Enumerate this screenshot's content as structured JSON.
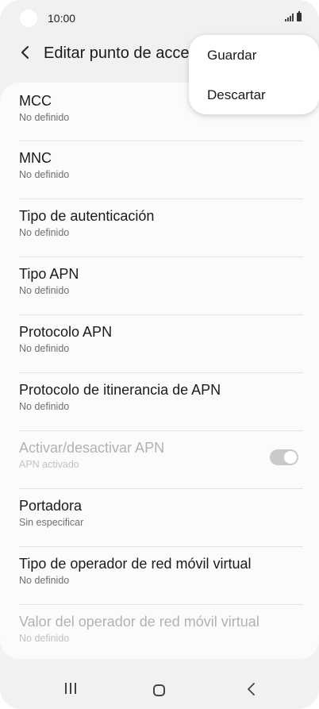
{
  "status_bar": {
    "time": "10:00"
  },
  "header": {
    "title": "Editar punto de acceso"
  },
  "menu": {
    "items": [
      "Guardar",
      "Descartar"
    ]
  },
  "settings": [
    {
      "title": "MCC",
      "subtitle": "No definido",
      "enabled": true
    },
    {
      "title": "MNC",
      "subtitle": "No definido",
      "enabled": true
    },
    {
      "title": "Tipo de autenticación",
      "subtitle": "No definido",
      "enabled": true
    },
    {
      "title": "Tipo APN",
      "subtitle": "No definido",
      "enabled": true
    },
    {
      "title": "Protocolo APN",
      "subtitle": "No definido",
      "enabled": true
    },
    {
      "title": "Protocolo de itinerancia de APN",
      "subtitle": "No definido",
      "enabled": true
    },
    {
      "title": "Activar/desactivar APN",
      "subtitle": "APN activado",
      "enabled": false,
      "toggle_on": true
    },
    {
      "title": "Portadora",
      "subtitle": "Sin especificar",
      "enabled": true
    },
    {
      "title": "Tipo de operador de red móvil virtual",
      "subtitle": "No definido",
      "enabled": true
    },
    {
      "title": "Valor del operador de red móvil virtual",
      "subtitle": "No definido",
      "enabled": false
    }
  ],
  "nav_bar": {
    "icons": [
      "recent-apps-icon",
      "home-icon",
      "back-icon"
    ]
  }
}
